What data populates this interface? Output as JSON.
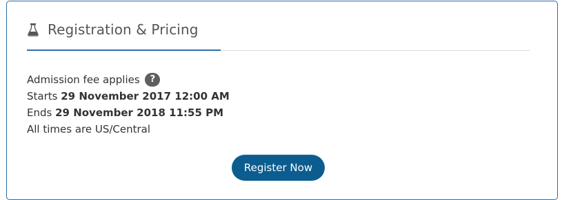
{
  "panel": {
    "title": "Registration & Pricing",
    "title_icon": "flask-icon"
  },
  "info": {
    "fee_text": "Admission fee applies",
    "help_icon_glyph": "?",
    "starts_prefix": "Starts",
    "starts_value": "29 November 2017 12:00 AM",
    "ends_prefix": "Ends",
    "ends_value": "29 November 2018 11:55 PM",
    "timezone_note": "All times are US/Central"
  },
  "actions": {
    "register_label": "Register Now"
  },
  "colors": {
    "accent": "#2f6ea8",
    "button": "#0b5c8f",
    "help_badge": "#5f5f5f"
  }
}
